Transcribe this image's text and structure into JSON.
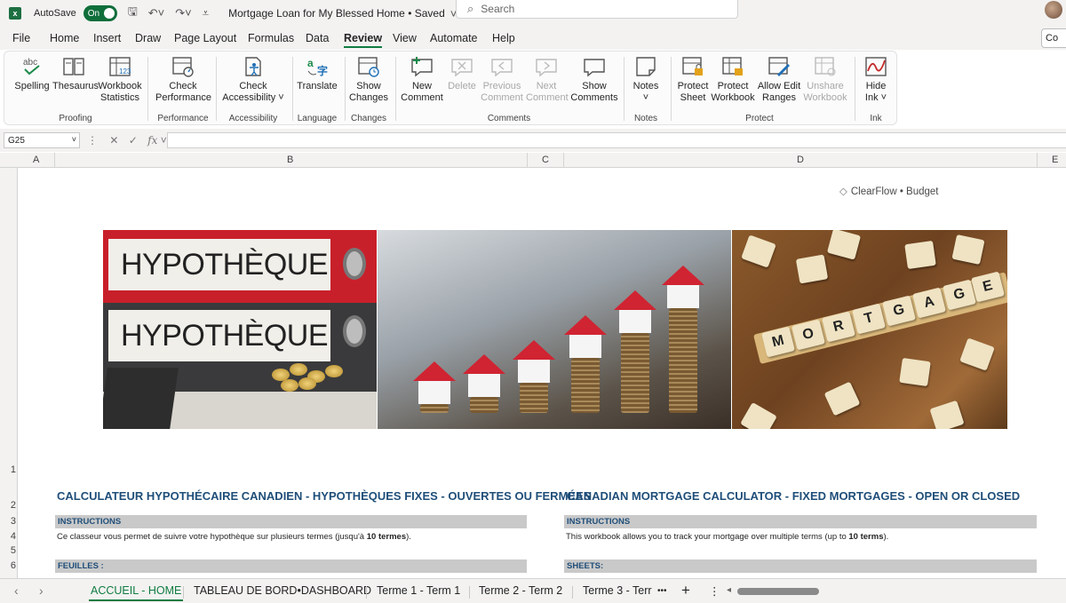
{
  "titlebar": {
    "autosave_label": "AutoSave",
    "toggle_state": "On",
    "document_title": "Mortgage Loan for My Blessed Home • Saved",
    "search_placeholder": "Search"
  },
  "menu": {
    "tabs": [
      "File",
      "Home",
      "Insert",
      "Draw",
      "Page Layout",
      "Formulas",
      "Data",
      "Review",
      "View",
      "Automate",
      "Help"
    ],
    "active": "Review",
    "share_label": "Co"
  },
  "ribbon": {
    "buttons": {
      "spelling": "Spelling",
      "thesaurus": "Thesaurus",
      "workbook_stats_1": "Workbook",
      "workbook_stats_2": "Statistics",
      "check_perf_1": "Check",
      "check_perf_2": "Performance",
      "check_access_1": "Check",
      "check_access_2": "Accessibility ˅",
      "translate": "Translate",
      "show_changes_1": "Show",
      "show_changes_2": "Changes",
      "new_comment_1": "New",
      "new_comment_2": "Comment",
      "delete": "Delete",
      "prev_comment_1": "Previous",
      "prev_comment_2": "Comment",
      "next_comment_1": "Next",
      "next_comment_2": "Comment",
      "show_comments_1": "Show",
      "show_comments_2": "Comments",
      "notes": "Notes",
      "protect_sheet_1": "Protect",
      "protect_sheet_2": "Sheet",
      "protect_wb_1": "Protect",
      "protect_wb_2": "Workbook",
      "allow_edit_1": "Allow Edit",
      "allow_edit_2": "Ranges",
      "unshare_1": "Unshare",
      "unshare_2": "Workbook",
      "hide_ink_1": "Hide",
      "hide_ink_2": "Ink ˅"
    },
    "groups": {
      "proofing": "Proofing",
      "performance": "Performance",
      "accessibility": "Accessibility",
      "language": "Language",
      "changes": "Changes",
      "comments": "Comments",
      "notes": "Notes",
      "protect": "Protect",
      "ink": "Ink"
    }
  },
  "formula_bar": {
    "name_box": "G25",
    "fx": "fx"
  },
  "grid": {
    "columns": [
      "A",
      "B",
      "C",
      "D",
      "E"
    ],
    "rows": [
      "1",
      "2",
      "3",
      "4",
      "5",
      "6"
    ]
  },
  "sheet": {
    "brand": "ClearFlow • Budget",
    "images": {
      "binder_text": "HYPOTHÈQUE",
      "tiles": [
        "M",
        "O",
        "R",
        "T",
        "G",
        "A",
        "G",
        "E"
      ]
    },
    "fr": {
      "heading": "CALCULATEUR HYPOTHÉCAIRE CANADIEN - HYPOTHÈQUES FIXES - OUVERTES OU FERMÉES",
      "instructions_label": "INSTRUCTIONS",
      "body_pre": "Ce classeur vous permet de suivre votre hypothèque sur plusieurs termes (jusqu'à ",
      "body_bold": "10 termes",
      "body_post": ").",
      "sheets_label": "FEUILLES :"
    },
    "en": {
      "heading": "CANADIAN MORTGAGE CALCULATOR - FIXED MORTGAGES - OPEN OR CLOSED",
      "instructions_label": "INSTRUCTIONS",
      "body_pre": "This workbook allows you to track your mortgage over multiple terms (up to ",
      "body_bold": "10 terms",
      "body_post": ").",
      "sheets_label": "SHEETS:"
    }
  },
  "sheet_tabs": {
    "tabs": [
      "ACCUEIL - HOME",
      "TABLEAU DE BORD•DASHBOARD",
      "Terme 1 - Term 1",
      "Terme 2 - Term 2",
      "Terme 3 - Terr"
    ],
    "active": "ACCUEIL - HOME",
    "more": "•••",
    "add": "+",
    "options": "⋮"
  },
  "colors": {
    "accent": "#107c41",
    "heading": "#1f4e79",
    "section_bar": "#c9c9c9"
  }
}
